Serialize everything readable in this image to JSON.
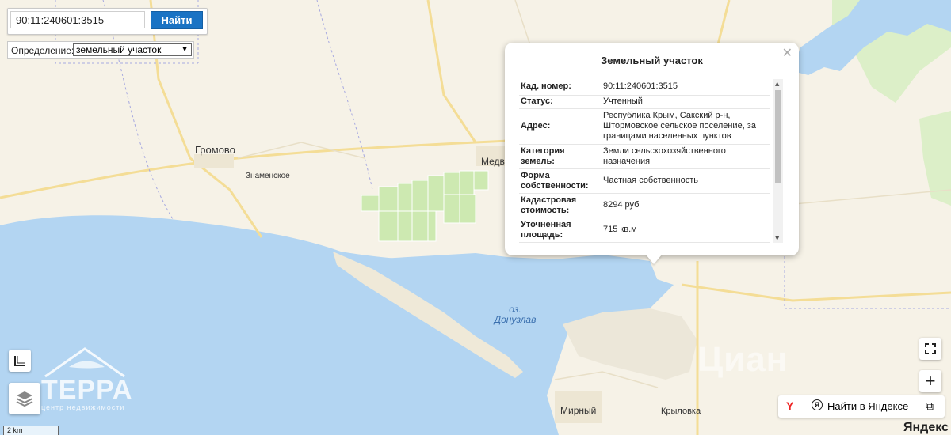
{
  "search": {
    "value": "90:11:240601:3515",
    "button_label": "Найти",
    "definition_label": "Определение:",
    "definition_selected": "земельный участок"
  },
  "map_labels": {
    "gromovo": "Громово",
    "znamenskoe": "Знаменское",
    "medv": "Медв",
    "lake_line1": "оз.",
    "lake_line2": "Донузлав",
    "mirny": "Мирный",
    "krylovka": "Крыловка"
  },
  "popup": {
    "title": "Земельный участок",
    "rows": [
      {
        "key": "Кад. номер:",
        "value": "90:11:240601:3515"
      },
      {
        "key": "Статус:",
        "value": "Учтенный"
      },
      {
        "key": "Адрес:",
        "value": "Республика Крым, Сакский р-н, Штормовское сельское поселение, за границами населенных пунктов"
      },
      {
        "key": "Категория земель:",
        "value": "Земли сельскохозяйственного назначения"
      },
      {
        "key": "Форма собственности:",
        "value": "Частная собственность"
      },
      {
        "key": "Кадастровая стоимость:",
        "value": "8294 руб"
      },
      {
        "key": "Уточненная площадь:",
        "value": "715 кв.м"
      }
    ]
  },
  "controls": {
    "yandex_search_label": "Найти в Яндексе",
    "scale_label": "2 km",
    "yandex_logo": "Яндекс"
  },
  "watermarks": {
    "terra_name": "ТЕРРА",
    "terra_sub": "центр недвижимости",
    "cian": "Циан"
  },
  "colors": {
    "water": "#b3d5f2",
    "land": "#f6f2e7",
    "field": "#cde9b1",
    "road": "#f4dd96",
    "button": "#1a73c4"
  }
}
